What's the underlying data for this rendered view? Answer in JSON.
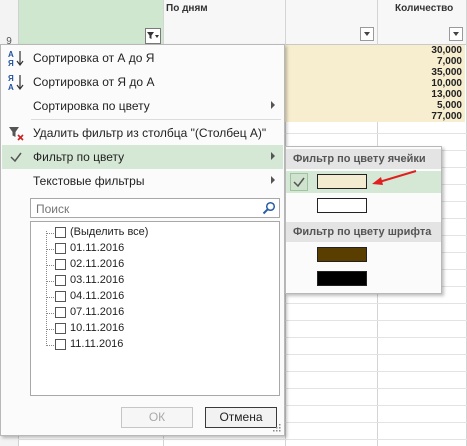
{
  "sheet": {
    "row_number": "9",
    "columns": [
      {
        "header": "По дням"
      },
      {
        "header": "Количество"
      }
    ],
    "quantities": [
      "30,000",
      "7,000",
      "35,000",
      "10,000",
      "13,000",
      "5,000",
      "77,000"
    ],
    "highlight_color": "#f7edcf"
  },
  "menu": {
    "items": [
      {
        "label": "Сортировка от А до Я",
        "icon": "sort-ascending-icon"
      },
      {
        "label": "Сортировка от Я до А",
        "icon": "sort-descending-icon"
      },
      {
        "label": "Сортировка по цвету",
        "has_submenu": true
      },
      {
        "label": "Удалить фильтр из столбца \"(Столбец A)\"",
        "icon": "clear-filter-icon"
      },
      {
        "label": "Фильтр по цвету",
        "has_submenu": true,
        "checked": true
      },
      {
        "label": "Текстовые фильтры",
        "has_submenu": true
      }
    ],
    "search_placeholder": "Поиск",
    "values": [
      "(Выделить все)",
      "01.11.2016",
      "02.11.2016",
      "03.11.2016",
      "04.11.2016",
      "07.11.2016",
      "10.11.2016",
      "11.11.2016"
    ],
    "ok_label": "ОК",
    "cancel_label": "Отмена"
  },
  "color_submenu": {
    "cell_color_header": "Фильтр по цвету ячейки",
    "cell_colors": [
      "#f3ecd0",
      "#ffffff"
    ],
    "font_color_header": "Фильтр по цвету шрифта",
    "font_colors": [
      "#5a3e00",
      "#000000"
    ],
    "selected_color": "#f3ecd0",
    "accent": "#d5e8d5",
    "arrow_color": "#e02020"
  }
}
